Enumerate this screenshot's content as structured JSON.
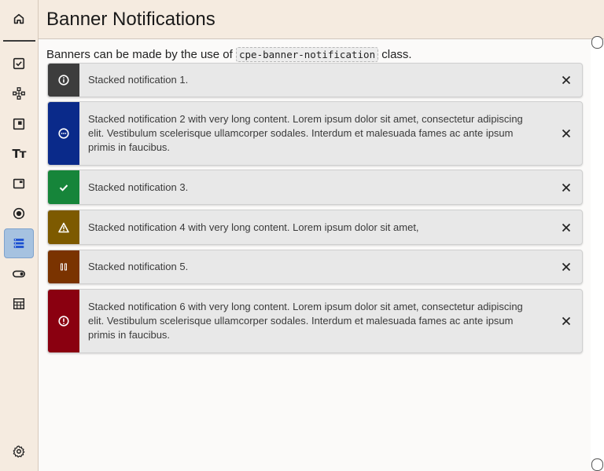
{
  "header": {
    "title": "Banner Notifications"
  },
  "intro": {
    "before": "Banners can be made by the use of ",
    "code": "cpe-banner-notification",
    "after": " class."
  },
  "sidebar": {
    "items": [
      {
        "icon": "home-icon",
        "active": false
      },
      {
        "icon": "checkbox-icon",
        "active": false
      },
      {
        "icon": "diagram-icon",
        "active": false
      },
      {
        "icon": "panel-icon",
        "active": false
      },
      {
        "icon": "typography-icon",
        "label": "Tт",
        "active": false
      },
      {
        "icon": "window-icon",
        "active": false
      },
      {
        "icon": "radio-icon",
        "active": false
      },
      {
        "icon": "list-icon",
        "active": true
      },
      {
        "icon": "toggle-icon",
        "active": false
      },
      {
        "icon": "table-icon",
        "active": false
      },
      {
        "icon": "gear-icon",
        "active": false
      }
    ]
  },
  "banners": [
    {
      "text": "Stacked notification 1.",
      "color": "#3d3d3d",
      "icon": "info-icon"
    },
    {
      "text": "Stacked notification 2 with very long content. Lorem ipsum dolor sit amet, consectetur adipiscing elit. Vestibulum scelerisque ullamcorper sodales. Interdum et malesuada fames ac ante ipsum primis in faucibus.",
      "color": "#0a2a8a",
      "icon": "ellipsis-circle-icon"
    },
    {
      "text": "Stacked notification 3.",
      "color": "#16853a",
      "icon": "check-icon"
    },
    {
      "text": "Stacked notification 4 with very long content. Lorem ipsum dolor sit amet,",
      "color": "#7d5a00",
      "icon": "warning-icon"
    },
    {
      "text": "Stacked notification 5.",
      "color": "#7a3300",
      "icon": "pause-icon"
    },
    {
      "text": "Stacked notification 6 with very long content. Lorem ipsum dolor sit amet, consectetur adipiscing elit. Vestibulum scelerisque ullamcorper sodales. Interdum et malesuada fames ac ante ipsum primis in faucibus.",
      "color": "#8a0010",
      "icon": "error-icon"
    }
  ]
}
